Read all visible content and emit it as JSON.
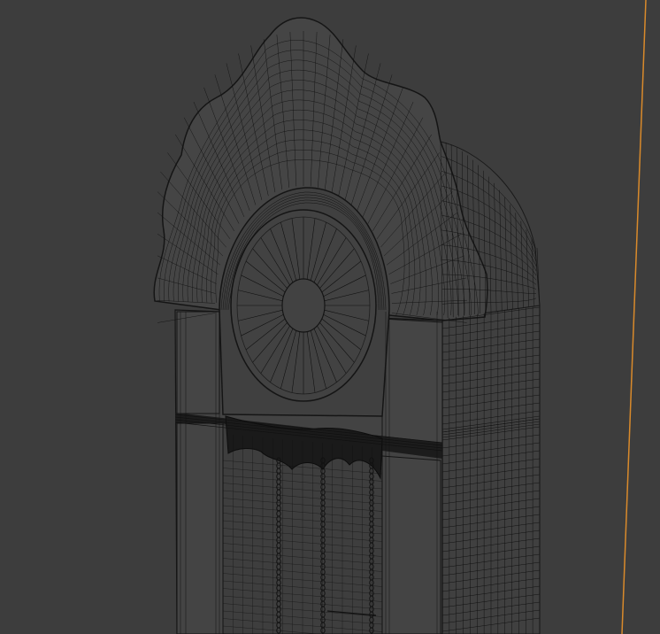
{
  "viewport": {
    "background_color": "#3d3d3d",
    "mode": "wireframe"
  },
  "scene": {
    "object": "grandfather-clock",
    "wire_color": "#111111",
    "panel_fill": "#424242",
    "axis_line_color": "#d98a2b"
  }
}
